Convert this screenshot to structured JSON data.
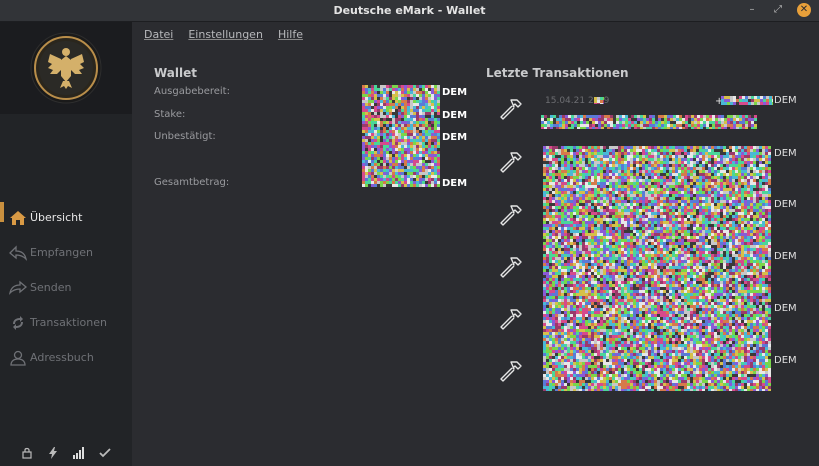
{
  "window": {
    "title": "Deutsche eMark - Wallet"
  },
  "menu": {
    "items": [
      "Datei",
      "Einstellungen",
      "Hilfe"
    ]
  },
  "sidebar": {
    "items": [
      {
        "label": "Übersicht",
        "icon": "home-icon",
        "active": true
      },
      {
        "label": "Empfangen",
        "icon": "receive-icon",
        "active": false
      },
      {
        "label": "Senden",
        "icon": "send-icon",
        "active": false
      },
      {
        "label": "Transaktionen",
        "icon": "transactions-icon",
        "active": false
      },
      {
        "label": "Adressbuch",
        "icon": "address-book-icon",
        "active": false
      }
    ],
    "status_icons": [
      "lock-icon",
      "staking-bolt-icon",
      "signal-bars-icon",
      "synced-check-icon"
    ]
  },
  "wallet": {
    "title": "Wallet",
    "labels": {
      "available": "Ausgabebereit:",
      "stake": "Stake:",
      "unconfirmed": "Unbestätigt:",
      "total": "Gesamtbetrag:"
    },
    "unit": "DEM"
  },
  "transactions": {
    "title": "Letzte Transaktionen",
    "first_date": "15.04.21 2",
    "first_date_suffix": "9",
    "amount_prefix": "+",
    "unit": "DEM",
    "count": 6
  },
  "colors": {
    "accent": "#c9903f",
    "background": "#2b2c30",
    "sidebar": "#222427"
  }
}
